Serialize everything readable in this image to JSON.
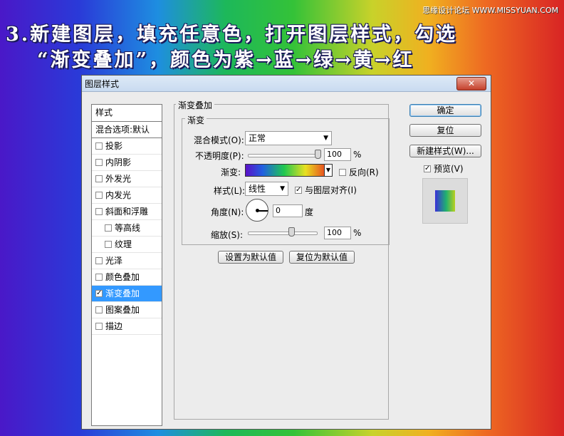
{
  "caption": {
    "line1": "3.新建图层，填充任意色，打开图层样式，勾选",
    "line2": "“渐变叠加”，颜色为紫→蓝→绿→黄→红",
    "watermark": "思缘设计论坛 WWW.MISSYUAN.COM"
  },
  "dialog": {
    "title": "图层样式",
    "close_glyph": "✕"
  },
  "styles_list": {
    "header": "样式",
    "blend_options": "混合选项:默认",
    "items": [
      {
        "label": "投影",
        "checked": false
      },
      {
        "label": "内阴影",
        "checked": false
      },
      {
        "label": "外发光",
        "checked": false
      },
      {
        "label": "内发光",
        "checked": false
      },
      {
        "label": "斜面和浮雕",
        "checked": false
      },
      {
        "label": "等高线",
        "checked": false
      },
      {
        "label": "纹理",
        "checked": false
      },
      {
        "label": "光泽",
        "checked": false
      },
      {
        "label": "颜色叠加",
        "checked": false
      },
      {
        "label": "渐变叠加",
        "checked": true
      },
      {
        "label": "图案叠加",
        "checked": false
      },
      {
        "label": "描边",
        "checked": false
      }
    ]
  },
  "panel": {
    "group_title": "渐变叠加",
    "subgroup_title": "渐变",
    "blend_mode_label": "混合模式(O):",
    "blend_mode_value": "正常",
    "opacity_label": "不透明度(P):",
    "opacity_value": "100",
    "percent": "%",
    "gradient_label": "渐变:",
    "reverse_label": "反向(R)",
    "reverse_checked": false,
    "style_label": "样式(L):",
    "style_value": "线性",
    "align_label": "与图层对齐(I)",
    "align_checked": true,
    "angle_label": "角度(N):",
    "angle_value": "0",
    "angle_unit": "度",
    "scale_label": "缩放(S):",
    "scale_value": "100",
    "set_default": "设置为默认值",
    "reset_default": "复位为默认值"
  },
  "buttons": {
    "ok": "确定",
    "reset": "复位",
    "new_style": "新建样式(W)...",
    "preview_label": "预览(V)",
    "preview_checked": true
  },
  "colors": {
    "selection": "#3399ff",
    "gradient": [
      "#5a10c8",
      "#2060e0",
      "#20c850",
      "#e8e020",
      "#e82020"
    ]
  }
}
